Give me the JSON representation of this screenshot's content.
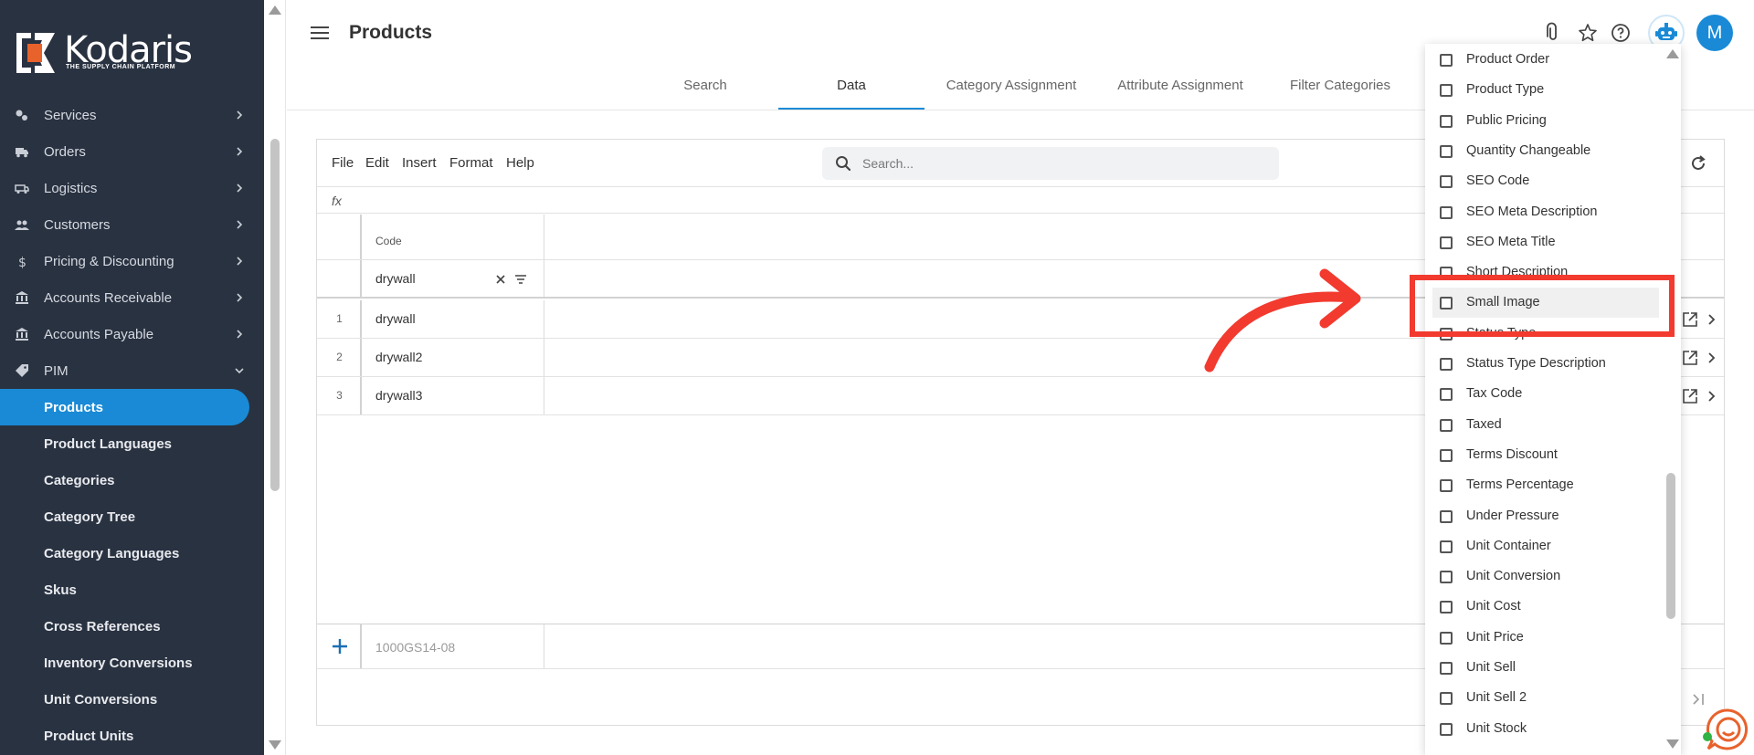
{
  "brand": {
    "name": "Kodaris",
    "tagline": "THE SUPPLY CHAIN PLATFORM",
    "accent": "#1a8ad6",
    "logo_orange": "#e8622c"
  },
  "sidebar": {
    "items": [
      {
        "label": "Services",
        "icon": "services-icon"
      },
      {
        "label": "Orders",
        "icon": "truck-icon"
      },
      {
        "label": "Logistics",
        "icon": "delivery-icon"
      },
      {
        "label": "Customers",
        "icon": "people-icon"
      },
      {
        "label": "Pricing & Discounting",
        "icon": "dollar-icon"
      },
      {
        "label": "Accounts Receivable",
        "icon": "bank-icon"
      },
      {
        "label": "Accounts Payable",
        "icon": "bank-icon"
      },
      {
        "label": "PIM",
        "icon": "tag-icon"
      }
    ],
    "pim_items": [
      "Products",
      "Product Languages",
      "Categories",
      "Category Tree",
      "Category Languages",
      "Skus",
      "Cross References",
      "Inventory Conversions",
      "Unit Conversions",
      "Product Units"
    ],
    "active": "Products"
  },
  "header": {
    "title": "Products",
    "avatar_initial": "M"
  },
  "tabs": [
    "Search",
    "Data",
    "Category Assignment",
    "Attribute Assignment",
    "Filter Categories"
  ],
  "active_tab": "Data",
  "grid": {
    "menu": [
      "File",
      "Edit",
      "Insert",
      "Format",
      "Help"
    ],
    "search_placeholder": "Search...",
    "fx": "fx",
    "column": "Code",
    "filter_value": "drywall",
    "rows": [
      {
        "num": "1",
        "code": "drywall"
      },
      {
        "num": "2",
        "code": "drywall2"
      },
      {
        "num": "3",
        "code": "drywall3"
      }
    ],
    "new_row_placeholder": "1000GS14-08"
  },
  "column_picker": {
    "items": [
      "Product Order",
      "Product Type",
      "Public Pricing",
      "Quantity Changeable",
      "SEO Code",
      "SEO Meta Description",
      "SEO Meta Title",
      "Short Description",
      "Small Image",
      "Status Type",
      "Status Type Description",
      "Tax Code",
      "Taxed",
      "Terms Discount",
      "Terms Percentage",
      "Under Pressure",
      "Unit Container",
      "Unit Conversion",
      "Unit Cost",
      "Unit Price",
      "Unit Sell",
      "Unit Sell 2",
      "Unit Stock"
    ],
    "highlighted": "Small Image"
  },
  "annotation_color": "#f23a2f"
}
